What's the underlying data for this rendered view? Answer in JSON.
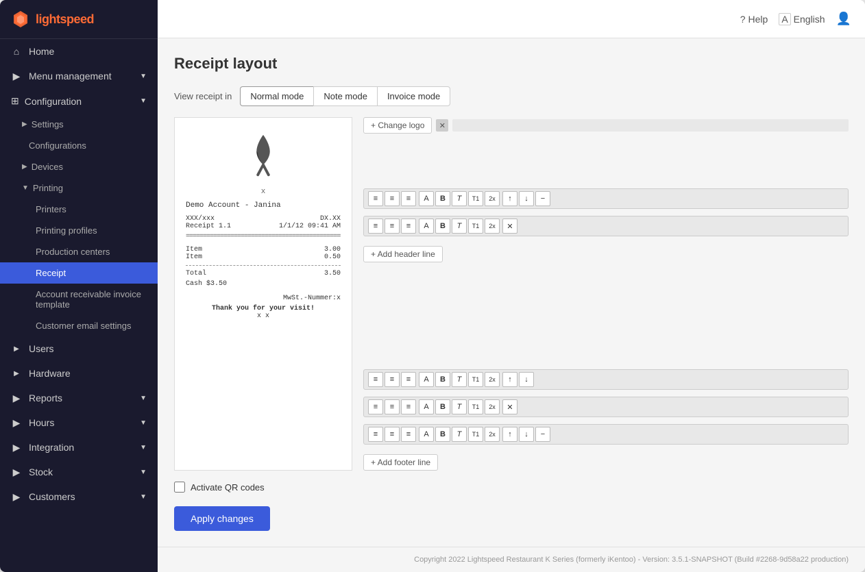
{
  "app": {
    "title": "Lightspeed",
    "logo_text": "lightspeed"
  },
  "topbar": {
    "help_label": "Help",
    "language_label": "English",
    "language_icon": "A"
  },
  "sidebar": {
    "items": [
      {
        "id": "home",
        "label": "Home",
        "icon": "home"
      },
      {
        "id": "menu-management",
        "label": "Menu management",
        "icon": "menu",
        "has_chevron": true
      },
      {
        "id": "configuration",
        "label": "Configuration",
        "icon": "grid",
        "expanded": true
      },
      {
        "id": "settings",
        "label": "Settings",
        "sub": true,
        "has_chevron": true
      },
      {
        "id": "configurations",
        "label": "Configurations",
        "sub": true
      },
      {
        "id": "devices",
        "label": "Devices",
        "sub": true,
        "has_chevron": true
      },
      {
        "id": "printing",
        "label": "Printing",
        "sub": true,
        "expanded": true
      },
      {
        "id": "printers",
        "label": "Printers",
        "sub2": true
      },
      {
        "id": "printing-profiles",
        "label": "Printing profiles",
        "sub2": true
      },
      {
        "id": "production-centers",
        "label": "Production centers",
        "sub2": true
      },
      {
        "id": "receipt",
        "label": "Receipt",
        "sub2": true,
        "active": true
      },
      {
        "id": "account-receivable",
        "label": "Account receivable invoice template",
        "sub2": true
      },
      {
        "id": "customer-email",
        "label": "Customer email settings",
        "sub2": true
      },
      {
        "id": "users",
        "label": "Users",
        "has_chevron": true
      },
      {
        "id": "hardware",
        "label": "Hardware",
        "has_chevron": true
      },
      {
        "id": "reports",
        "label": "Reports",
        "has_chevron": true,
        "icon": "chart"
      },
      {
        "id": "hours",
        "label": "Hours",
        "has_chevron": true,
        "icon": "clock"
      },
      {
        "id": "integration",
        "label": "Integration",
        "has_chevron": true,
        "icon": "grid"
      },
      {
        "id": "stock",
        "label": "Stock",
        "has_chevron": true,
        "icon": "box"
      },
      {
        "id": "customers",
        "label": "Customers",
        "has_chevron": true,
        "icon": "user"
      }
    ]
  },
  "page": {
    "title": "Receipt layout",
    "view_receipt_label": "View receipt in",
    "tabs": [
      {
        "id": "normal",
        "label": "Normal mode",
        "active": true
      },
      {
        "id": "note",
        "label": "Note mode",
        "active": false
      },
      {
        "id": "invoice",
        "label": "Invoice mode",
        "active": false
      }
    ]
  },
  "receipt_preview": {
    "x_placeholder": "x",
    "demo_account": "Demo Account - Janina",
    "xxx": "XXX/xxx",
    "dx": "DX.XX",
    "receipt_num": "Receipt 1.1",
    "date": "1/1/12 09:41 AM",
    "item1": "Item",
    "item1_price": "3.00",
    "item2": "Item",
    "item2_price": "0.50",
    "total_label": "Total",
    "total_price": "3.50",
    "cash_label": "Cash $3.50",
    "mwst": "MwSt.-Nummer:x",
    "thank_you": "Thank you for your visit!",
    "xx": "x x"
  },
  "edit_panel": {
    "change_logo_label": "+ Change logo",
    "add_header_line_label": "+ Add header line",
    "add_footer_line_label": "+ Add footer line"
  },
  "footer": {
    "qr_label": "Activate QR codes",
    "apply_label": "Apply changes",
    "copyright": "Copyright 2022 Lightspeed Restaurant K Series (formerly iKentoo) - Version: 3.5.1-SNAPSHOT (Build #2268-9d58a22 production)"
  }
}
